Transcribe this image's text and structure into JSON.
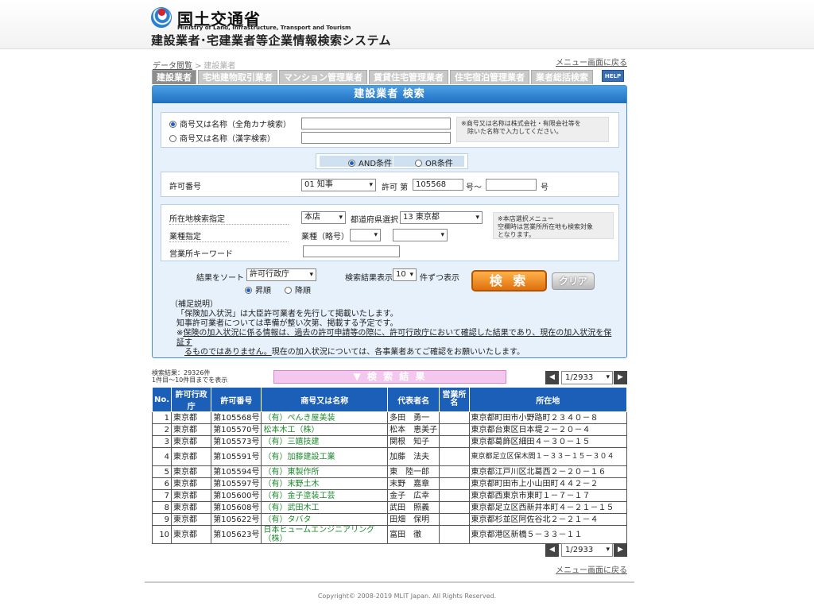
{
  "header": {
    "ministry_jp": "国土交通省",
    "ministry_en": "Ministry of Land, Infrastructure, Transport and Tourism",
    "system_title": "建設業者･宅建業者等企業情報検索システム"
  },
  "breadcrumb": {
    "link": "データ閲覧",
    "separator": ">",
    "current": "建設業者"
  },
  "menu_link": "メニュー画面に戻る",
  "tabs": [
    {
      "label": "建設業者",
      "active": true
    },
    {
      "label": "宅地建物取引業者",
      "active": false
    },
    {
      "label": "マンション管理業者",
      "active": false
    },
    {
      "label": "賃貸住宅管理業者",
      "active": false
    },
    {
      "label": "住宅宿泊管理業者",
      "active": false
    },
    {
      "label": "業者総括検索",
      "active": false
    }
  ],
  "help_label": "HELP",
  "form": {
    "title": "建設業者 検索",
    "name_kana_label": "商号又は名称（全角カナ検索）",
    "name_kanji_label": "商号又は名称（漢字検索）",
    "name_kana_value": "",
    "name_kanji_value": "",
    "name_note_line1": "※商号又は名称は株式会社・有限会社等を",
    "name_note_line2": "　除いた名称で入力してください。",
    "and_label": "AND条件",
    "or_label": "OR条件",
    "permit_label": "許可番号",
    "permit_type": "01 知事",
    "permit_text": "許可 第",
    "permit_from": "105568",
    "permit_to_text": "号～",
    "permit_to": "",
    "permit_suffix": "号",
    "location_label": "所在地検索指定",
    "location_select": "本店",
    "prefecture_label": "都道府県選択",
    "prefecture_select": "13 東京都",
    "location_note_line1": "※本店選択メニュー",
    "location_note_line2": "空欄時は営業所所在地も検索対象",
    "location_note_line3": "となります。",
    "industry_label": "業種指定",
    "industry_sub_label": "業種（略号）",
    "industry_select1": "",
    "industry_select2": "",
    "keyword_label": "営業所キーワード",
    "keyword_value": "",
    "sort_label": "結果をソート",
    "sort_select": "許可行政庁",
    "asc_label": "昇順",
    "desc_label": "降順",
    "per_page_label": "検索結果表示",
    "per_page_value": "10",
    "per_page_suffix": "件ずつ表示",
    "search_button": "検 索",
    "clear_button": "クリア",
    "supp_title": "（補足説明）",
    "supp_line1": "「保険加入状況」は大臣許可業者を先行して掲載いたします。",
    "supp_line2": "知事許可業者については準備が整い次第、掲載する予定です。",
    "supp_line3a": "※",
    "supp_line3b": "保険の加入状況に係る情報は、過去の許可申請等の際に、許可行政庁において確認した結果であり、現在の加入状況を保証す",
    "supp_line4a": "るものではありません。",
    "supp_line4b": "現在の加入状況については、各事業者あてご確認をお願いいたします。"
  },
  "results": {
    "count_text": "検索結果：29326件",
    "range_text": "1件目～10件目までを表示",
    "bar_label": "▼ 検 索 結 果",
    "page_select": "1/2933",
    "prev": "◀",
    "next": "▶",
    "headers": [
      "No.",
      "許可行政庁",
      "許可番号",
      "商号又は名称",
      "代表者名",
      "営業所名",
      "所在地"
    ],
    "rows": [
      {
        "no": "1",
        "auth": "東京都",
        "num": "第105568号",
        "name": "（有）ぺんき屋美装",
        "rep": "多田　勇一",
        "office": "",
        "addr": "東京都町田市小野路町２３４０－８"
      },
      {
        "no": "2",
        "auth": "東京都",
        "num": "第105570号",
        "name": "松本木工（株）",
        "rep": "松本　恵美子",
        "office": "",
        "addr": "東京都台東区日本堤２－２０－４"
      },
      {
        "no": "3",
        "auth": "東京都",
        "num": "第105573号",
        "name": "（有）三嬉技建",
        "rep": "関根　知子",
        "office": "",
        "addr": "東京都葛飾区細田４－３０－１５"
      },
      {
        "no": "4",
        "auth": "東京都",
        "num": "第105591号",
        "name": "（有）加藤建設工業",
        "rep": "加藤　法夫",
        "office": "",
        "addr": "東京都足立区保木間１－３３－１５－３０４"
      },
      {
        "no": "5",
        "auth": "東京都",
        "num": "第105594号",
        "name": "（有）東製作所",
        "rep": "東　陸一郎",
        "office": "",
        "addr": "東京都江戸川区北葛西２－２０－１６"
      },
      {
        "no": "6",
        "auth": "東京都",
        "num": "第105597号",
        "name": "（有）末野土木",
        "rep": "末野　嘉章",
        "office": "",
        "addr": "東京都町田市上小山田町４４２－２"
      },
      {
        "no": "7",
        "auth": "東京都",
        "num": "第105600号",
        "name": "（有）金子塗装工芸",
        "rep": "金子　広幸",
        "office": "",
        "addr": "東京都西東京市東町１－７－１７"
      },
      {
        "no": "8",
        "auth": "東京都",
        "num": "第105608号",
        "name": "（有）武田木工",
        "rep": "武田　照義",
        "office": "",
        "addr": "東京都足立区西新井本町４－２１－１５"
      },
      {
        "no": "9",
        "auth": "東京都",
        "num": "第105622号",
        "name": "（有）タバタ",
        "rep": "田畑　保明",
        "office": "",
        "addr": "東京都杉並区阿佐谷北２－２１－４"
      },
      {
        "no": "10",
        "auth": "東京都",
        "num": "第105623号",
        "name": "日本ヒュームエンジニアリング（株）",
        "rep": "富田　徹",
        "office": "",
        "addr": "東京都港区新橋５－３３－１１"
      }
    ]
  },
  "footer": {
    "copyright": "Copyright© 2008-2019 MLIT Japan. All Rights Reserved."
  }
}
